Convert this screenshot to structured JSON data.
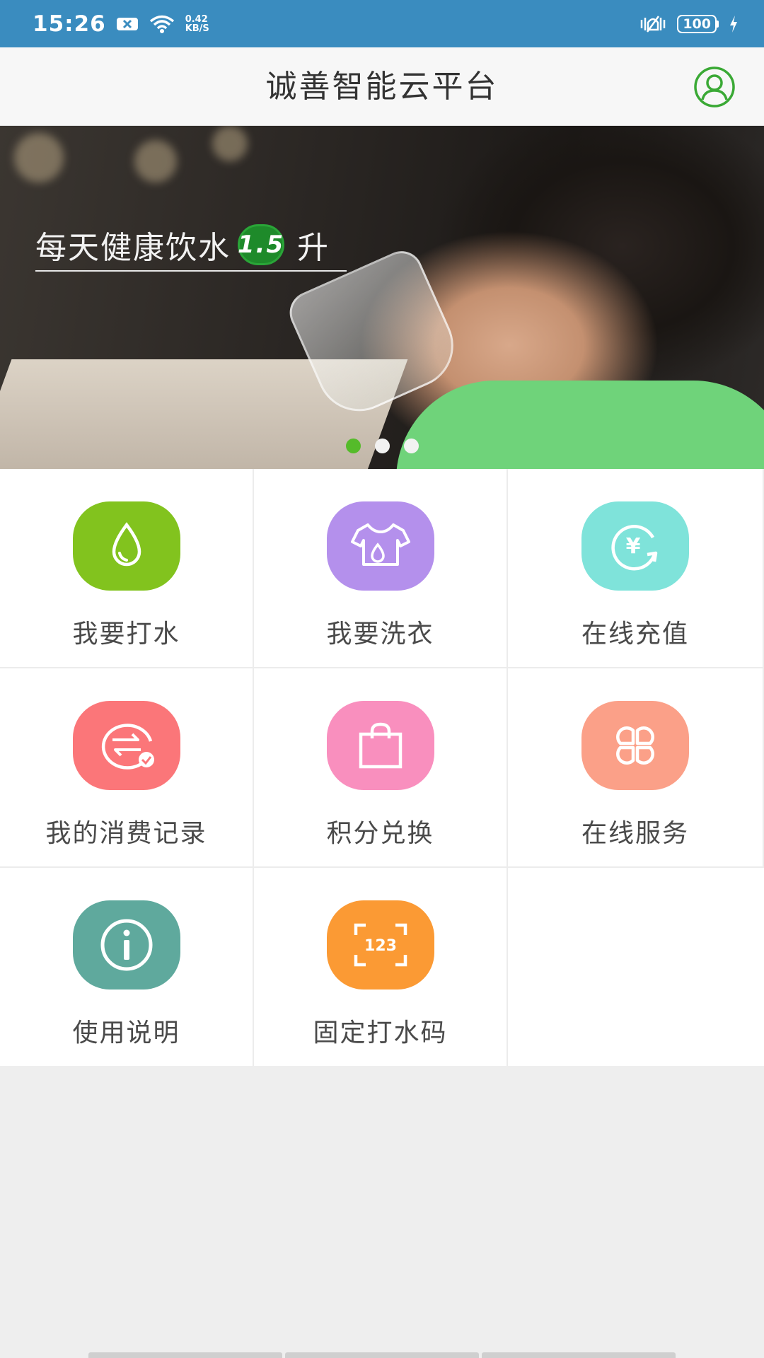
{
  "status_bar": {
    "time": "15:26",
    "net_speed_value": "0.42",
    "net_speed_unit": "KB/S",
    "battery": "100",
    "icons": [
      "notification-x-icon",
      "wifi-icon",
      "vibrate-icon",
      "battery-icon",
      "charging-icon"
    ]
  },
  "app_bar": {
    "title": "诚善智能云平台",
    "profile_icon": "user-profile-icon",
    "accent": "#3aa935"
  },
  "banner": {
    "headline": "每天健康饮水",
    "badge": "1.5",
    "unit": "升",
    "slide_count": 3,
    "active_slide": 0
  },
  "menu": {
    "items": [
      {
        "label": "我要打水",
        "icon": "water-drop-icon",
        "color": "#82c31e"
      },
      {
        "label": "我要洗衣",
        "icon": "laundry-shirt-icon",
        "color": "#b490ec"
      },
      {
        "label": "在线充值",
        "icon": "yen-recharge-icon",
        "color": "#7fe3da"
      },
      {
        "label": "我的消费记录",
        "icon": "transaction-record-icon",
        "color": "#fb7679"
      },
      {
        "label": "积分兑换",
        "icon": "shopping-bag-icon",
        "color": "#f98fbe"
      },
      {
        "label": "在线服务",
        "icon": "four-leaf-service-icon",
        "color": "#fba088"
      },
      {
        "label": "使用说明",
        "icon": "info-icon",
        "color": "#5fa99d"
      },
      {
        "label": "固定打水码",
        "icon": "scan-code-123-icon",
        "color": "#fb9a34"
      }
    ]
  }
}
